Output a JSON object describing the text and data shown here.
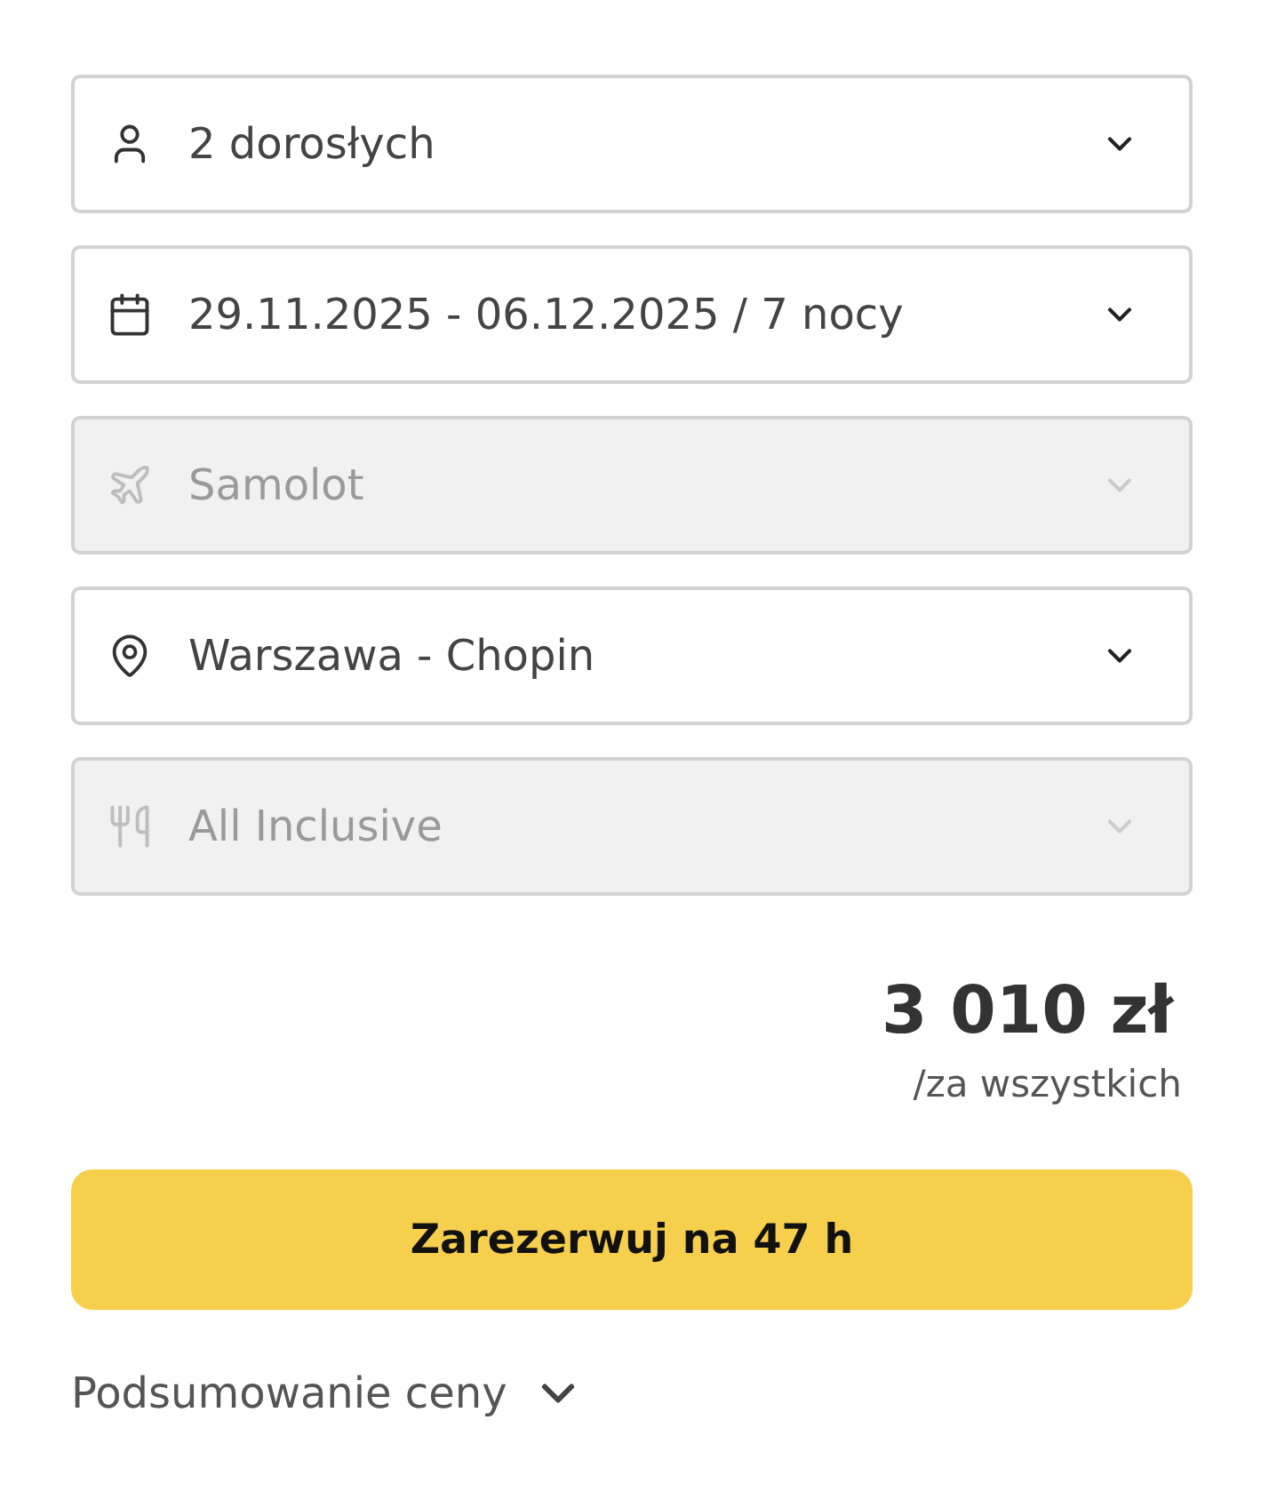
{
  "fields": [
    {
      "kind": "guests",
      "value": "2 dorosłych",
      "disabled": false
    },
    {
      "kind": "dates",
      "value": "29.11.2025 - 06.12.2025 / 7 nocy",
      "disabled": false
    },
    {
      "kind": "transport",
      "value": "Samolot",
      "disabled": true
    },
    {
      "kind": "airport",
      "value": "Warszawa - Chopin",
      "disabled": false
    },
    {
      "kind": "board",
      "value": "All Inclusive",
      "disabled": true
    }
  ],
  "price": {
    "amount": "3 010 zł",
    "note": "/za wszystkich"
  },
  "book_button": {
    "label": "Zarezerwuj na 47 h"
  },
  "price_summary": {
    "label": "Podsumowanie ceny",
    "expanded": false
  }
}
